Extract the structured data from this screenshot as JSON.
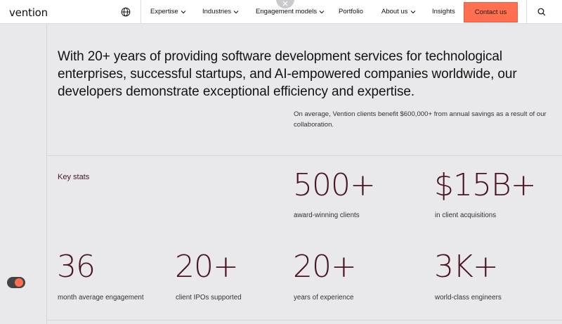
{
  "header": {
    "logo": "vention",
    "nav": [
      {
        "label": "Expertise",
        "dropdown": true
      },
      {
        "label": "Industries",
        "dropdown": true
      },
      {
        "label": "Engagement models",
        "dropdown": true
      },
      {
        "label": "Portfolio",
        "dropdown": false
      },
      {
        "label": "About us",
        "dropdown": true
      },
      {
        "label": "Insights",
        "dropdown": false
      }
    ],
    "contact_label": "Contact us"
  },
  "hero": {
    "headline": "With 20+ years of providing software development services for technological enterprises, successful startups, and AI-empowered companies worldwide, our developers demonstrate exceptional efficiency and expertise.",
    "subtext": "On average, Vention clients benefit $600,000+ from annual savings as a result of our collaboration."
  },
  "stats": {
    "section_label": "Key stats",
    "items": [
      {
        "value": "500+",
        "label": "award-winning clients"
      },
      {
        "value": "$15B+",
        "label": "in client acquisitions"
      },
      {
        "value": "36",
        "label": "month average engagement"
      },
      {
        "value": "20+",
        "label": "client IPOs supported"
      },
      {
        "value": "20+",
        "label": "years of experience"
      },
      {
        "value": "3K+",
        "label": "world-class engineers"
      }
    ]
  },
  "colors": {
    "accent": "#ff6f50",
    "stat_text": "#4a1424",
    "background": "#e9e8ea"
  }
}
